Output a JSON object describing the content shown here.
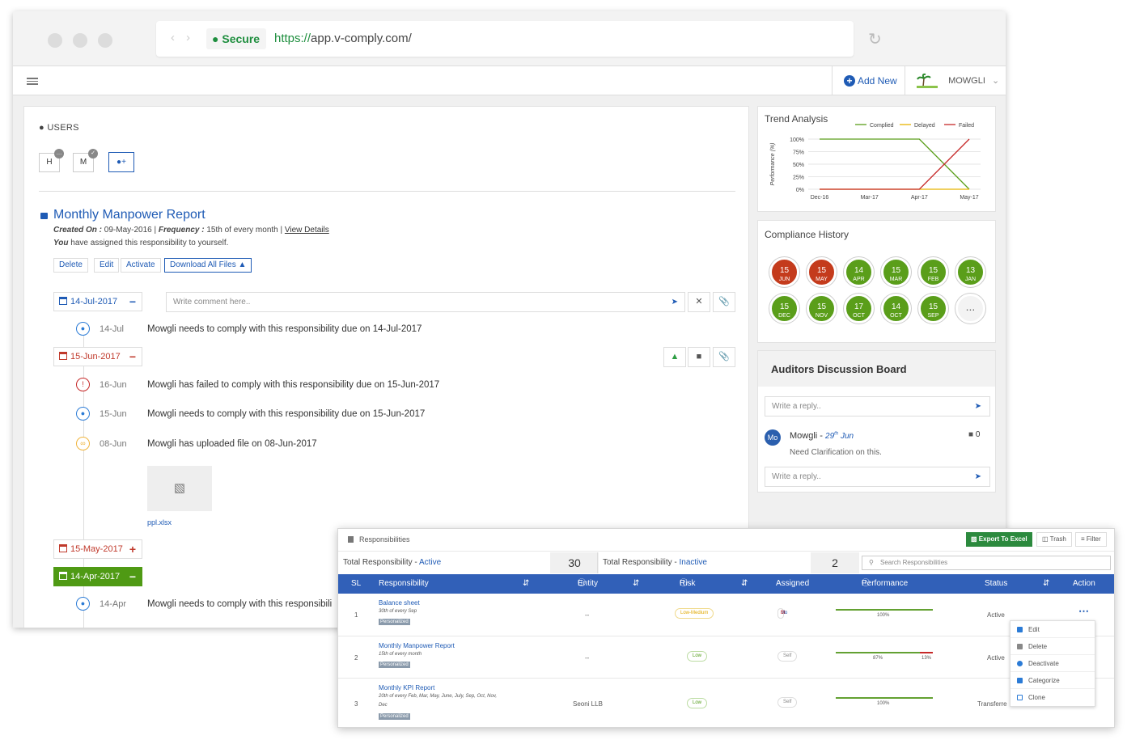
{
  "browser": {
    "secure_label": "Secure",
    "url_scheme": "https://",
    "url_rest": "app.v-comply.com/"
  },
  "topbar": {
    "add_new": "Add New",
    "user_name": "MOWGLI"
  },
  "users": {
    "heading": "USERS",
    "items": [
      "H",
      "M"
    ]
  },
  "responsibility": {
    "title": "Monthly Manpower Report",
    "created_label": "Created On :",
    "created_value": "09-May-2016",
    "frequency_label": "Frequency :",
    "frequency_value": "15th of every month",
    "view_details": "View Details",
    "assigned_you": "You",
    "assigned_text": "have assigned this responsibility to yourself.",
    "buttons": [
      "Delete",
      "Edit",
      "Activate",
      "Download All Files"
    ]
  },
  "timeline": {
    "comment_placeholder": "Write comment here..",
    "groups": [
      {
        "date": "14-Jul-2017",
        "color": "#1f5bb5"
      },
      {
        "date": "15-Jun-2017",
        "color": "#c0392b"
      },
      {
        "date": "15-May-2017",
        "color": "#c0392b"
      },
      {
        "date": "14-Apr-2017",
        "color": "#ffffff"
      }
    ],
    "entries": [
      {
        "date": "14-Jul",
        "text": "Mowgli needs to comply with this responsibility due on 14-Jul-2017"
      },
      {
        "date": "16-Jun",
        "text": "Mowgli has failed to comply with this responsibility due on 15-Jun-2017"
      },
      {
        "date": "15-Jun",
        "text": "Mowgli needs to comply with this responsibility due on 15-Jun-2017"
      },
      {
        "date": "08-Jun",
        "text": "Mowgli has uploaded file on 08-Jun-2017"
      },
      {
        "date": "14-Apr",
        "text": "Mowgli needs to comply with this responsibili"
      }
    ],
    "file_name": "ppl.xlsx"
  },
  "trend": {
    "title": "Trend Analysis",
    "ylabel": "Performance (%)",
    "legend": [
      "Complied",
      "Delayed",
      "Failed"
    ],
    "colors": [
      "#5a9e1a",
      "#e8b400",
      "#c62828"
    ],
    "yticks": [
      "100%",
      "75%",
      "50%",
      "25%",
      "0%"
    ],
    "xticks": [
      "Dec-16",
      "Mar-17",
      "Apr-17",
      "May-17"
    ]
  },
  "chart_data": {
    "type": "line",
    "title": "Trend Analysis",
    "ylabel": "Performance (%)",
    "x": [
      "Dec-16",
      "Mar-17",
      "Apr-17",
      "May-17"
    ],
    "ylim": [
      0,
      100
    ],
    "series": [
      {
        "name": "Complied",
        "values": [
          100,
          100,
          100,
          0
        ]
      },
      {
        "name": "Delayed",
        "values": [
          0,
          0,
          0,
          0
        ]
      },
      {
        "name": "Failed",
        "values": [
          0,
          0,
          0,
          100
        ]
      }
    ]
  },
  "history": {
    "title": "Compliance History",
    "items": [
      {
        "d": "15",
        "m": "JUN",
        "c": "#c43b1c"
      },
      {
        "d": "15",
        "m": "MAY",
        "c": "#c43b1c"
      },
      {
        "d": "14",
        "m": "APR",
        "c": "#5a9e1a"
      },
      {
        "d": "15",
        "m": "MAR",
        "c": "#5a9e1a"
      },
      {
        "d": "15",
        "m": "FEB",
        "c": "#5a9e1a"
      },
      {
        "d": "13",
        "m": "JAN",
        "c": "#5a9e1a"
      },
      {
        "d": "15",
        "m": "DEC",
        "c": "#5a9e1a"
      },
      {
        "d": "15",
        "m": "NOV",
        "c": "#5a9e1a"
      },
      {
        "d": "17",
        "m": "OCT",
        "c": "#5a9e1a"
      },
      {
        "d": "14",
        "m": "OCT",
        "c": "#5a9e1a"
      },
      {
        "d": "15",
        "m": "SEP",
        "c": "#5a9e1a"
      }
    ],
    "more": "..."
  },
  "board": {
    "title": "Auditors Discussion Board",
    "reply_placeholder": "Write a reply..",
    "post_initials": "Mo",
    "post_author": "Mowgli -",
    "post_day": "29",
    "post_sup": "th",
    "post_month": "Jun",
    "post_text": "Need Clarification on this.",
    "post_count": "0"
  },
  "table": {
    "title": "Responsibilities",
    "export": "Export To Excel",
    "trash": "Trash",
    "filter": "Filter",
    "total_label": "Total Responsibility -",
    "active_label": "Active",
    "active_count": "30",
    "inactive_label": "Inactive",
    "inactive_count": "2",
    "search_placeholder": "Search Responsibilities",
    "columns": [
      "SL",
      "Responsibility",
      "Entity",
      "Risk Class",
      "Assigned",
      "Performance",
      "Status",
      "Action"
    ],
    "rows": [
      {
        "sl": "1",
        "name": "Balance sheet",
        "freq": "30th of every Sep",
        "tag": "Personalized",
        "entity": "--",
        "risk": "Low-Medium",
        "assigned": [
          "Mo",
          "Bt"
        ],
        "perf": "100%",
        "status": "Active"
      },
      {
        "sl": "2",
        "name": "Monthly Manpower Report",
        "freq": "15th of every month",
        "tag": "Personalized",
        "entity": "--",
        "risk": "Low",
        "assigned": [
          "Self"
        ],
        "perf": "87%",
        "perf2": "13%",
        "status": "Active"
      },
      {
        "sl": "3",
        "name": "Monthly KPI Report",
        "freq": "20th of every Feb, Mar, May, June, July, Sep, Oct, Nov,",
        "freq2": "Dec",
        "tag": "Personalized",
        "entity": "Seoni LLB",
        "risk": "Low",
        "assigned": [
          "Self"
        ],
        "perf": "100%",
        "status": "Transferre"
      }
    ],
    "menu": [
      "Edit",
      "Delete",
      "Deactivate",
      "Categorize",
      "Clone"
    ]
  }
}
